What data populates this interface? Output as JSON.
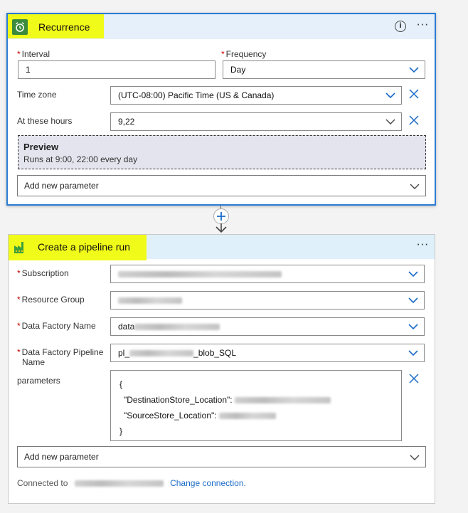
{
  "recurrence": {
    "title": "Recurrence",
    "info_icon": "info-icon",
    "more_glyph": "···",
    "interval_label": "Interval",
    "interval_value": "1",
    "frequency_label": "Frequency",
    "frequency_value": "Day",
    "timezone_label": "Time zone",
    "timezone_value": "(UTC-08:00) Pacific Time (US & Canada)",
    "hours_label": "At these hours",
    "hours_value": "9,22",
    "preview_title": "Preview",
    "preview_text": "Runs at 9:00, 22:00 every day",
    "add_param": "Add new parameter",
    "icon_color": "#3c8b3c"
  },
  "pipeline": {
    "title": "Create a pipeline run",
    "more_glyph": "···",
    "subscription_label": "Subscription",
    "resource_group_label": "Resource Group",
    "factory_label": "Data Factory Name",
    "factory_prefix": "data",
    "pipeline_label_1": "Data Factory Pipeline",
    "pipeline_label_2": "Name",
    "pipeline_prefix": "pl_",
    "pipeline_suffix": "_blob_SQL",
    "parameters_label": "parameters",
    "params_open": "{",
    "dest_key": "\"DestinationStore_Location\":",
    "source_key": "\"SourceStore_Location\":",
    "params_close": "}",
    "add_param": "Add new parameter",
    "connected_prefix": "Connected to",
    "change_connection": "Change connection.",
    "icon_color": "#f2c811"
  },
  "colors": {
    "highlight": "#f1fb19",
    "accent": "#2b7cd3",
    "chevron": "#1a6bc8",
    "required": "#c00000"
  }
}
